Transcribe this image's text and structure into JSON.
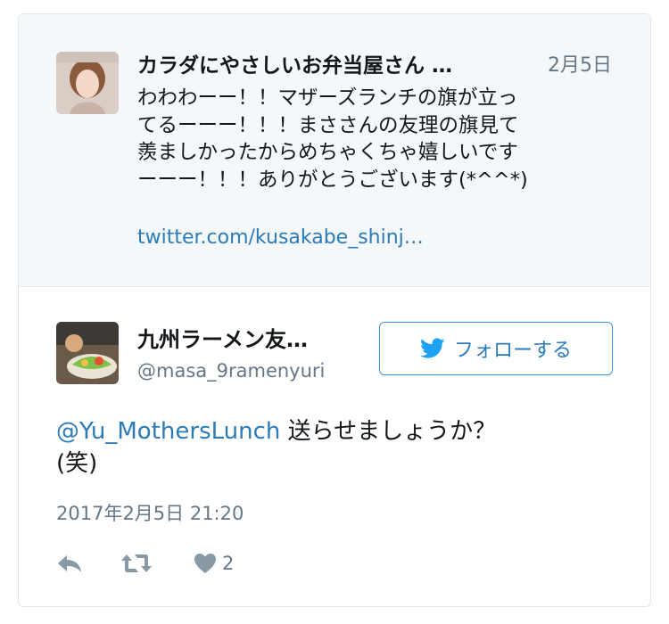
{
  "quoted_tweet": {
    "display_name": "カラダにやさしいお弁当屋さん …",
    "date": "2月5日",
    "text_lines": [
      "わわわーー！！マザーズランチの旗が立っ",
      "てるーーー！！！まささんの友理の旗見て",
      "羨ましかったからめちゃくちゃ嬉しいです",
      "ーーー！！！ありがとうございます(*^^*)"
    ],
    "link": "twitter.com/kusakabe_shinj…"
  },
  "main_tweet": {
    "display_name": "九州ラーメン友…",
    "handle": "@masa_9ramenyuri",
    "follow_label": "フォローする",
    "mention": "@Yu_MothersLunch",
    "text_rest": " 送らせましょうか？",
    "text_line2": "(笑)",
    "timestamp": "2017年2月5日 21:20",
    "like_count": "2"
  },
  "icons": [
    "reply-icon",
    "retweet-icon",
    "heart-icon",
    "twitter-bird-icon"
  ],
  "colors": {
    "link": "#2b7bb9",
    "muted": "#657786",
    "quoted_bg": "#f5f8fa",
    "border": "#e1e8ed"
  }
}
